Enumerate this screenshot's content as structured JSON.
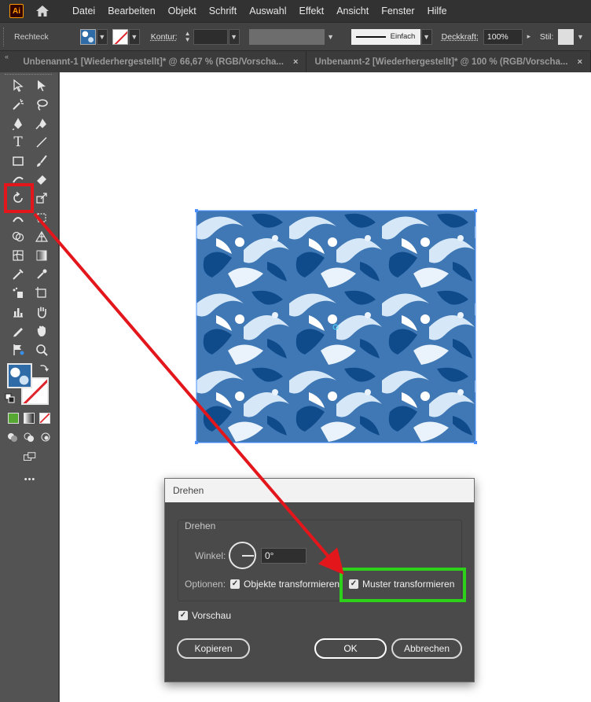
{
  "app": {
    "logo_text": "Ai"
  },
  "menu": {
    "items": [
      "Datei",
      "Bearbeiten",
      "Objekt",
      "Schrift",
      "Auswahl",
      "Effekt",
      "Ansicht",
      "Fenster",
      "Hilfe"
    ]
  },
  "control_bar": {
    "object_type": "Rechteck",
    "kontur_label": "Kontur:",
    "stroke_style": "Einfach",
    "deckkraft_label": "Deckkraft:",
    "deckkraft_value": "100%",
    "stil_label": "Stil:"
  },
  "tabs": [
    {
      "label": "Unbenannt-1 [Wiederhergestellt]* @ 66,67 % (RGB/Vorscha...",
      "close": "×"
    },
    {
      "label": "Unbenannt-2 [Wiederhergestellt]* @ 100 % (RGB/Vorscha...",
      "close": "×"
    }
  ],
  "toolbar": {
    "more_label": "•••"
  },
  "dialog": {
    "title": "Drehen",
    "group_title": "Drehen",
    "winkel_label": "Winkel:",
    "winkel_value": "0°",
    "optionen_label": "Optionen:",
    "objekte_label": "Objekte transformieren",
    "objekte_checked": true,
    "muster_label": "Muster transformieren",
    "muster_checked": true,
    "vorschau_label": "Vorschau",
    "vorschau_checked": true,
    "kopieren_label": "Kopieren",
    "ok_label": "OK",
    "abbrechen_label": "Abbrechen"
  },
  "colors": {
    "annotation_red": "#e3161c",
    "annotation_green": "#2ed11a",
    "pattern_dark": "#0f4a8a",
    "pattern_mid": "#3f78b5",
    "pattern_light": "#d6e8f7"
  }
}
